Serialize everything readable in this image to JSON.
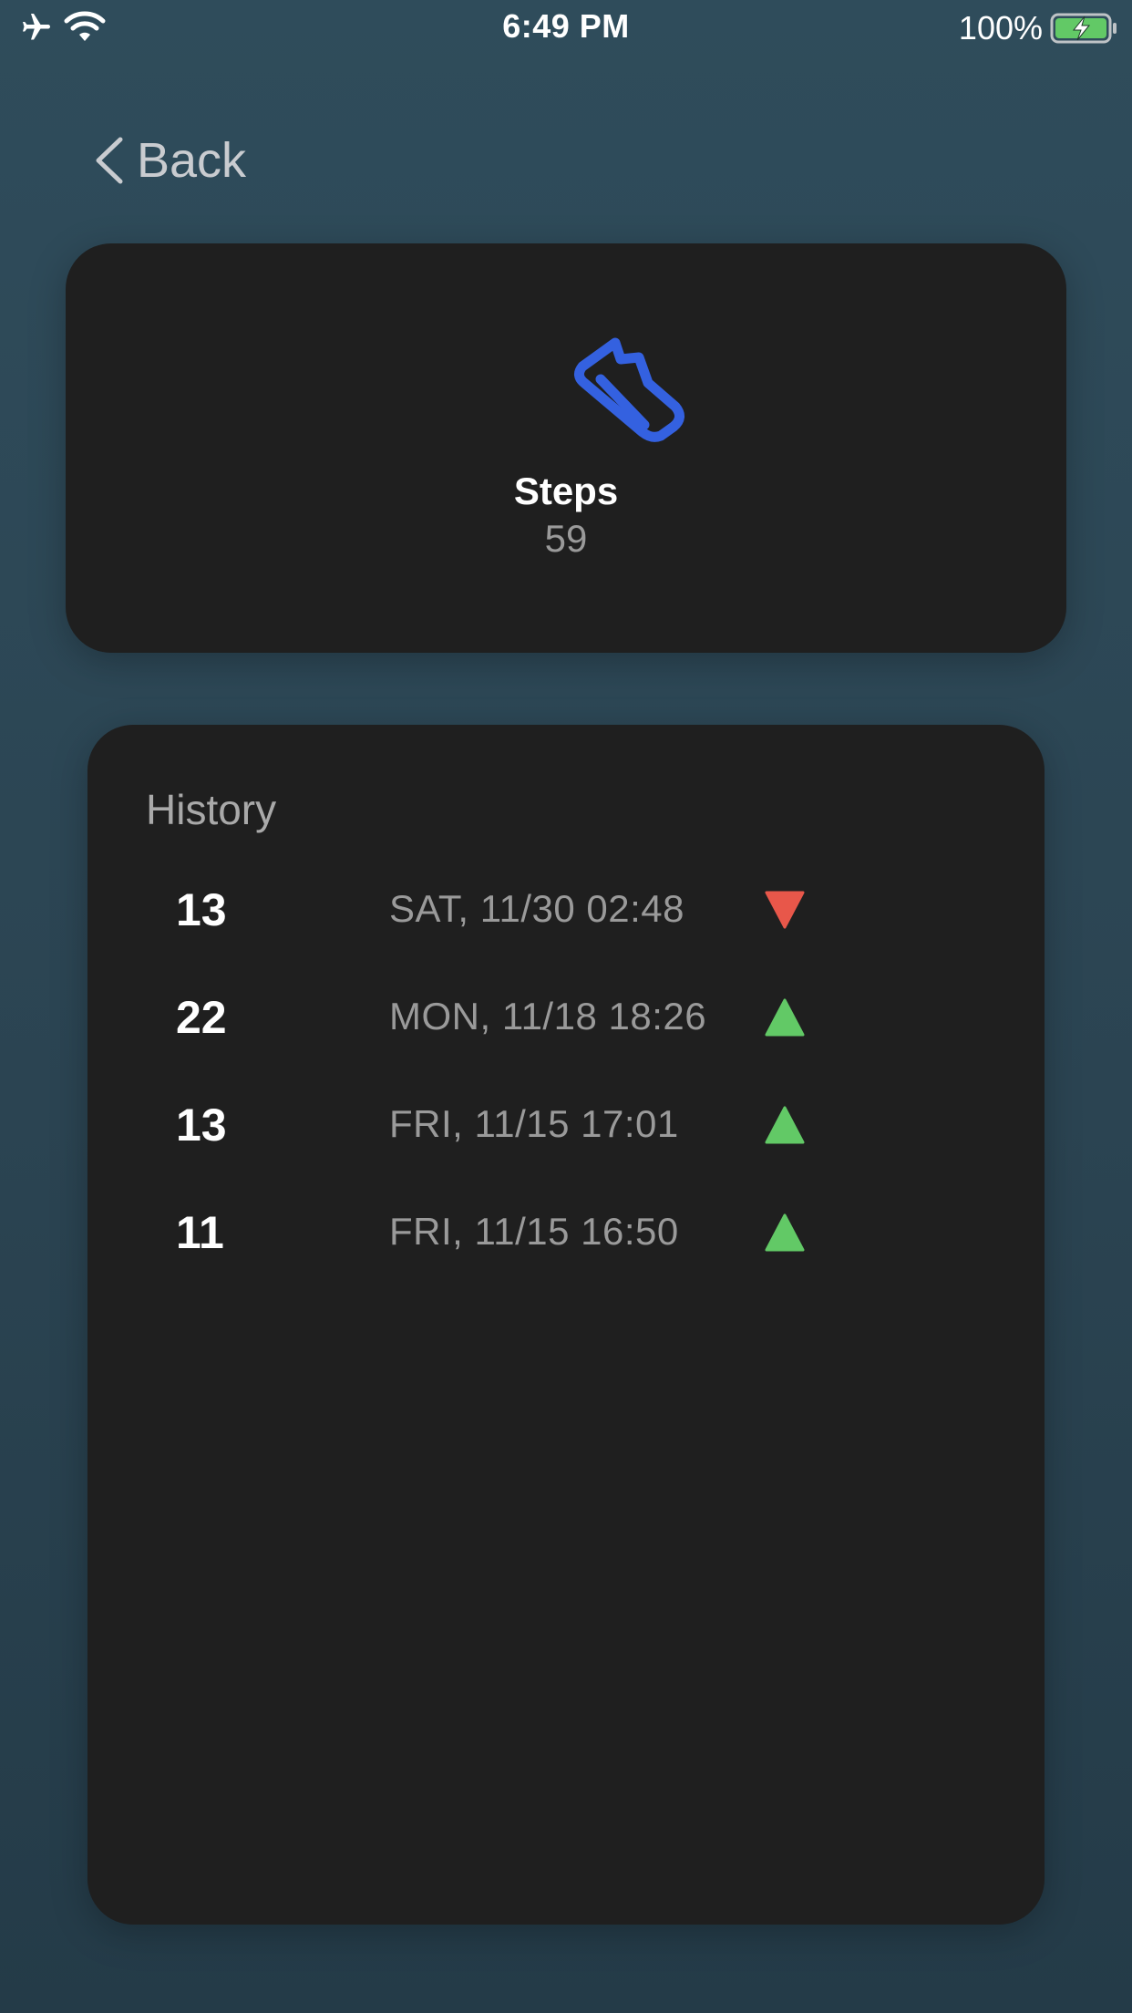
{
  "status_bar": {
    "time": "6:49 PM",
    "battery_percent": "100%",
    "icons": [
      "airplane-icon",
      "wifi-icon",
      "battery-charging-icon"
    ]
  },
  "nav": {
    "back_label": "Back"
  },
  "summary": {
    "icon": "shoe-icon",
    "title": "Steps",
    "value": "59",
    "accent_color": "#3461e0"
  },
  "history": {
    "title": "History",
    "rows": [
      {
        "value": "13",
        "date": "SAT, 11/30 02:48",
        "trend": "down"
      },
      {
        "value": "22",
        "date": "MON, 11/18 18:26",
        "trend": "up"
      },
      {
        "value": "13",
        "date": "FRI, 11/15 17:01",
        "trend": "up"
      },
      {
        "value": "11",
        "date": "FRI, 11/15 16:50",
        "trend": "up"
      }
    ],
    "trend_colors": {
      "up": "#62c966",
      "down": "#e8574a"
    }
  }
}
